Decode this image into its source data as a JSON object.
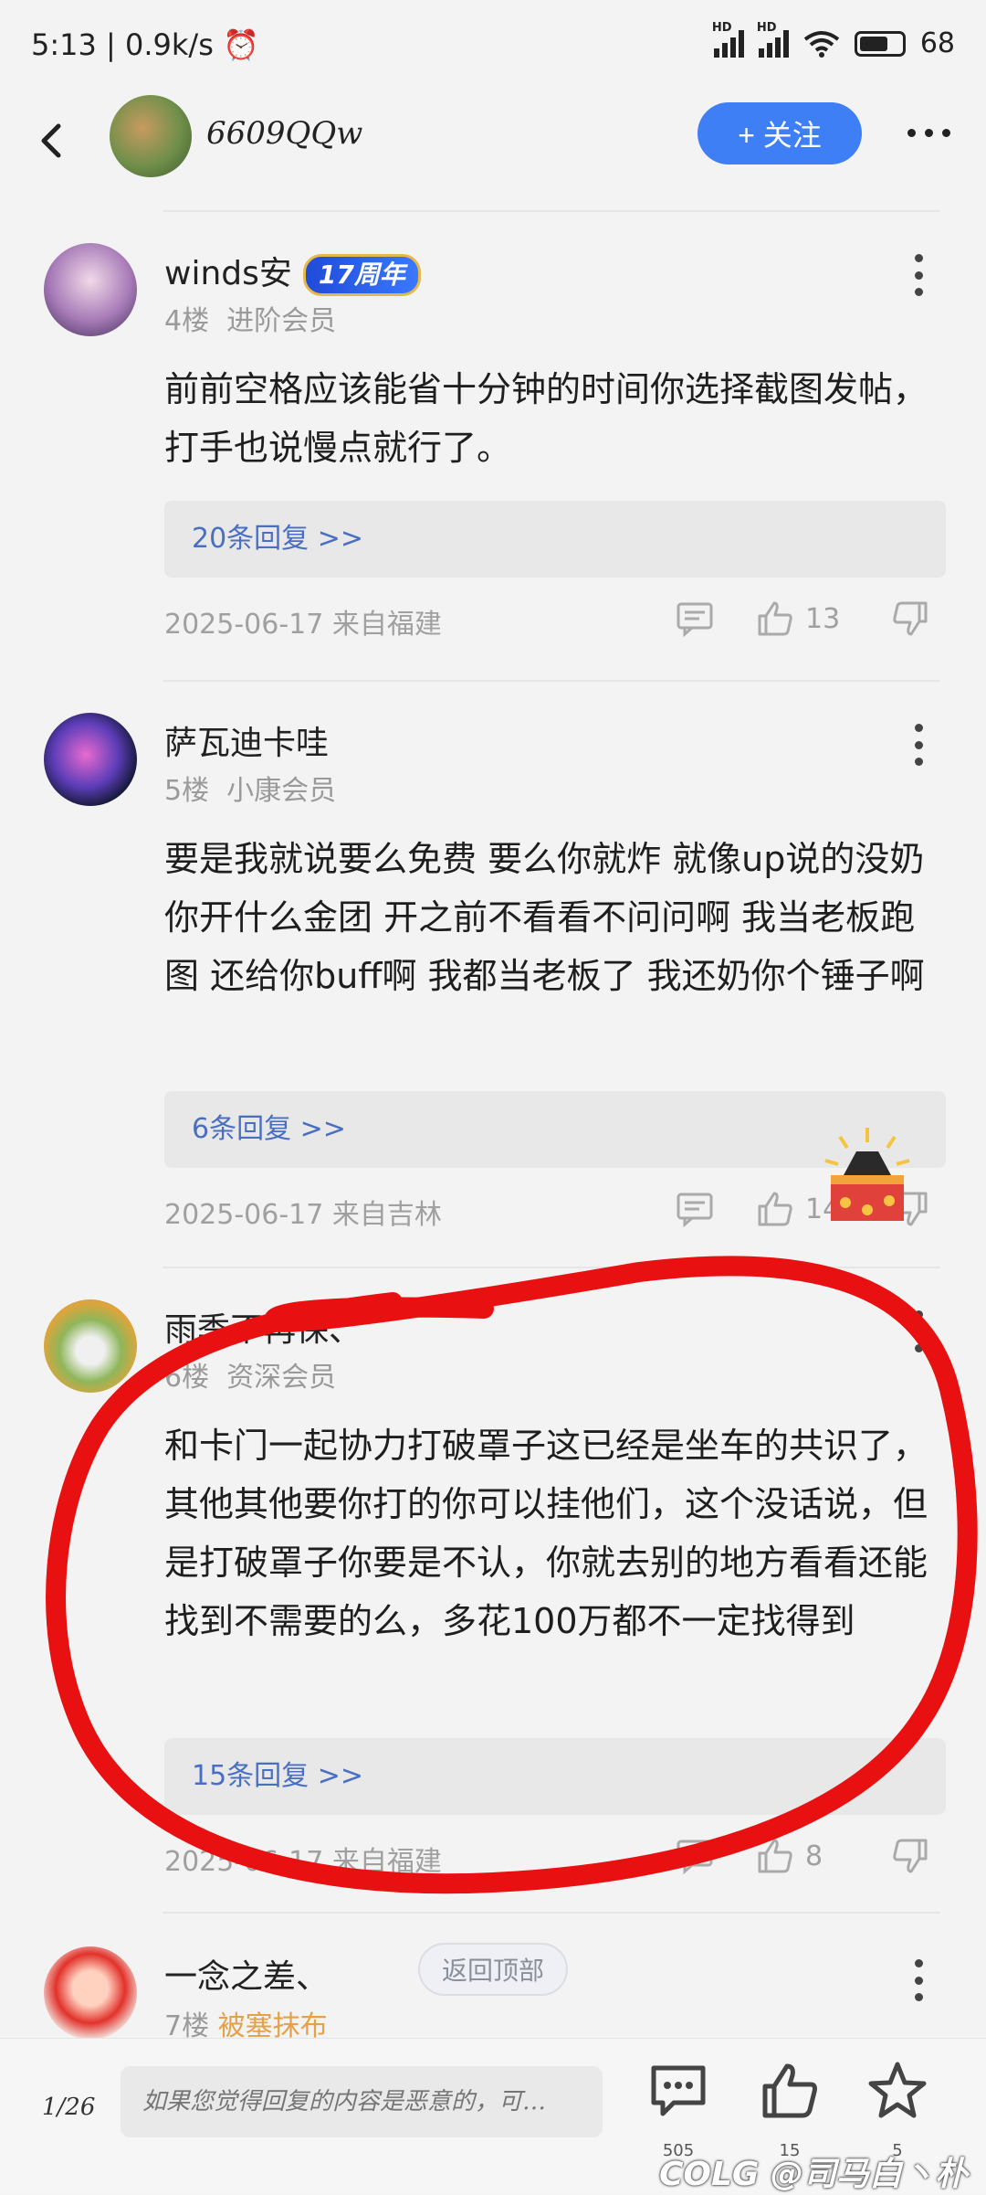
{
  "status_bar": {
    "time": "5:13",
    "speed": "0.9k/s",
    "battery": "68",
    "battery_level": 0.68,
    "signal_label": "HD"
  },
  "nav": {
    "title": "6609QQw",
    "follow_label": "+ 关注"
  },
  "posts": [
    {
      "username": "winds安",
      "badge": "17周年",
      "floor": "4楼",
      "level": "进阶会员",
      "content": "前前空格应该能省十分钟的时间你选择截图发帖，打手也说慢点就行了。",
      "replies": "20条回复 >>",
      "date": "2025-06-17 来自福建",
      "likes": "13"
    },
    {
      "username": "萨瓦迪卡哇",
      "floor": "5楼",
      "level": "小康会员",
      "content": "要是我就说要么免费 要么你就炸  就像up说的没奶你开什么金团 开之前不看看不问问啊 我当老板跑图 还给你buff啊  我都当老板了 我还奶你个锤子啊",
      "replies": "6条回复 >>",
      "date": "2025-06-17 来自吉林",
      "likes": "14"
    },
    {
      "username": "雨季不再保、",
      "floor": "6楼",
      "level": "资深会员",
      "content": "和卡门一起协力打破罩子这已经是坐车的共识了，其他其他要你打的你可以挂他们，这个没话说，但是打破罩子你要是不认，你就去别的地方看看还能找到不需要的么，多花100万都不一定找得到",
      "replies": "15条回复 >>",
      "date": "2025-06-17 来自福建",
      "likes": "8"
    },
    {
      "username": "一念之差、",
      "floor": "7楼",
      "level": "被塞抹布"
    }
  ],
  "back_to_top": "返回顶部",
  "bottom": {
    "page": "1/26",
    "placeholder": "如果您觉得回复的内容是恶意的，可…",
    "comments_count": "505",
    "likes_count": "15",
    "favorites_count": "5"
  },
  "watermark": "COLG @司马白丶朴"
}
